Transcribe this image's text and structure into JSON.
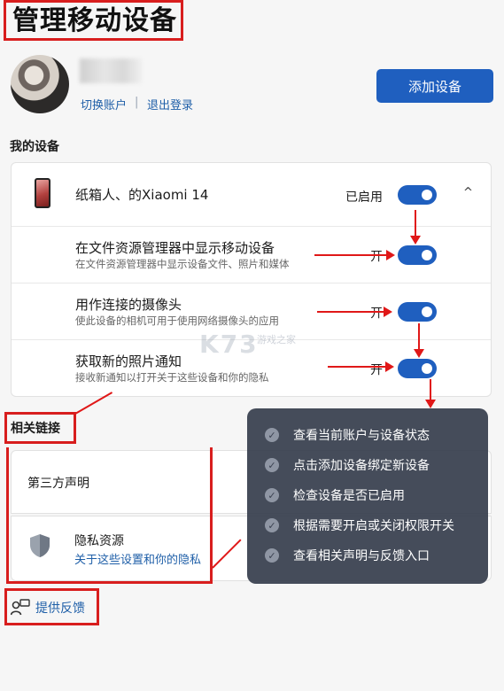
{
  "page": {
    "title": "管理移动设备"
  },
  "account": {
    "switch_label": "切换账户",
    "separator": "|",
    "logout_label": "退出登录",
    "add_device_label": "添加设备"
  },
  "my_devices": {
    "title": "我的设备",
    "device": {
      "name": "纸箱人、的Xiaomi 14",
      "status_label": "已启用",
      "enabled": true
    },
    "settings": [
      {
        "title": "在文件资源管理器中显示移动设备",
        "desc": "在文件资源管理器中显示设备文件、照片和媒体",
        "state_label": "开",
        "on": true
      },
      {
        "title": "用作连接的摄像头",
        "desc": "使此设备的相机可用于使用网络摄像头的应用",
        "state_label": "开",
        "on": true
      },
      {
        "title": "获取新的照片通知",
        "desc": "接收新通知以打开关于这些设备和你的隐私",
        "state_label": "开",
        "on": true
      }
    ]
  },
  "related": {
    "title": "相关链接",
    "third_party_label": "第三方声明",
    "privacy_label": "隐私资源",
    "privacy_link": "关于这些设置和你的隐私"
  },
  "feedback": {
    "label": "提供反馈"
  },
  "overlay": {
    "items": [
      "查看当前账户与设备状态",
      "点击添加设备绑定新设备",
      "检查设备是否已启用",
      "根据需要开启或关闭权限开关",
      "查看相关声明与反馈入口"
    ]
  },
  "watermark": {
    "text": "K73",
    "sub": "游戏之家"
  },
  "colors": {
    "accent": "#1f5fbf",
    "annotation": "#d81e1e",
    "overlay_bg": "#373e4e"
  }
}
